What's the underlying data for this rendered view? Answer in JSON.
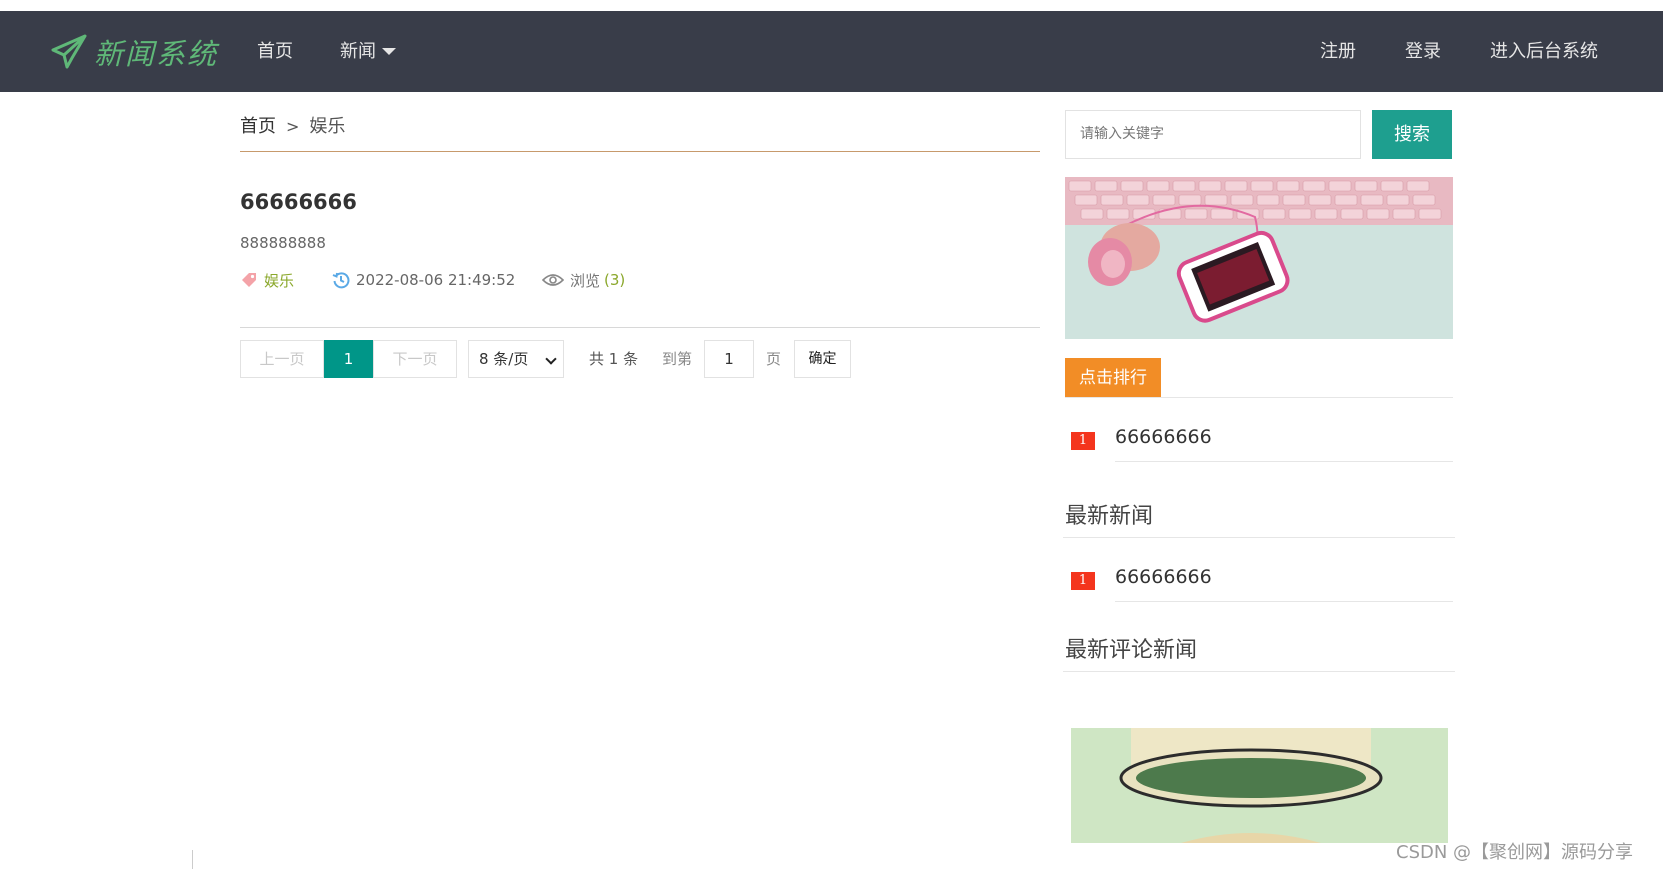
{
  "nav": {
    "logo_text": "新闻系统",
    "items": [
      {
        "label": "首页"
      },
      {
        "label": "新闻"
      }
    ],
    "right_items": [
      {
        "label": "注册"
      },
      {
        "label": "登录"
      },
      {
        "label": "进入后台系统"
      }
    ]
  },
  "breadcrumb": {
    "home": "首页",
    "separator": ">",
    "current": "娱乐"
  },
  "article": {
    "title": "66666666",
    "summary": "888888888",
    "category": "娱乐",
    "datetime": "2022-08-06 21:49:52",
    "views_label": "浏览",
    "views_count": "(3)"
  },
  "pager": {
    "prev": "上一页",
    "current": "1",
    "next": "下一页",
    "page_size": "8 条/页",
    "total": "共 1 条",
    "goto_label": "到第",
    "goto_value": "1",
    "page_unit": "页",
    "confirm": "确定"
  },
  "sidebar": {
    "search_placeholder": "请输入关键字",
    "search_button": "搜索",
    "hot_tab": "点击排行",
    "hot_items": [
      {
        "rank": "1",
        "title": "66666666"
      }
    ],
    "latest_title": "最新新闻",
    "latest_items": [
      {
        "rank": "1",
        "title": "66666666"
      }
    ],
    "commented_title": "最新评论新闻"
  },
  "watermark": "CSDN @【聚创网】源码分享",
  "colors": {
    "nav_bg": "#393d49",
    "accent_teal": "#009688",
    "logo_green": "#5fb878",
    "tab_orange": "#f28d26",
    "badge_red": "#f4351d"
  }
}
